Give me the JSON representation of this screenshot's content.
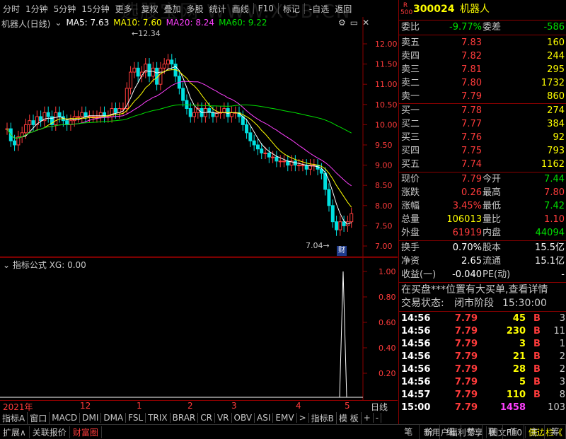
{
  "toolbar": {
    "watermark": "选股宝网 WWW.XGB.CN",
    "items": [
      "分时",
      "1分钟",
      "5分钟",
      "15分钟",
      "更多",
      "复权",
      "叠加",
      "多股",
      "统计",
      "画线",
      "F10",
      "标记",
      "-自选",
      "返回"
    ]
  },
  "stock": {
    "code": "300024",
    "name": "机器人",
    "badge_top": "R",
    "badge_bottom": "500"
  },
  "main_chart": {
    "title": "机器人(日线)",
    "ma": [
      {
        "label": "MA5: 7.63",
        "color": "#ffffff"
      },
      {
        "label": "MA10: 7.60",
        "color": "#ffff00"
      },
      {
        "label": "MA20: 8.24",
        "color": "#ff40ff"
      },
      {
        "label": "MA60: 9.22",
        "color": "#00e000"
      }
    ],
    "high_label": "12.34",
    "low_label": "7.04",
    "fin_badge": "财",
    "y_ticks": [
      "12.00",
      "11.50",
      "11.00",
      "10.50",
      "10.00",
      "9.50",
      "9.00",
      "8.50",
      "8.00",
      "7.50",
      "7.00"
    ]
  },
  "ind_chart": {
    "title": "指标公式 XG: 0.00",
    "y_ticks": [
      "1.00",
      "0.80",
      "0.60",
      "0.40",
      "0.20"
    ]
  },
  "x_axis": {
    "labels": [
      "2021年",
      "12",
      "1",
      "2",
      "3",
      "4",
      "5"
    ],
    "period": "日线"
  },
  "order_book": {
    "weibi_label": "委比",
    "weibi_value": "-9.77%",
    "weicha_label": "委差",
    "weicha_value": "-586",
    "sells": [
      {
        "label": "卖五",
        "price": "7.83",
        "vol": "160"
      },
      {
        "label": "卖四",
        "price": "7.82",
        "vol": "244"
      },
      {
        "label": "卖三",
        "price": "7.81",
        "vol": "295"
      },
      {
        "label": "卖二",
        "price": "7.80",
        "vol": "1732"
      },
      {
        "label": "卖一",
        "price": "7.79",
        "vol": "860"
      }
    ],
    "buys": [
      {
        "label": "买一",
        "price": "7.78",
        "vol": "274"
      },
      {
        "label": "买二",
        "price": "7.77",
        "vol": "384"
      },
      {
        "label": "买三",
        "price": "7.76",
        "vol": "92"
      },
      {
        "label": "买四",
        "price": "7.75",
        "vol": "793"
      },
      {
        "label": "买五",
        "price": "7.74",
        "vol": "1162"
      }
    ]
  },
  "quote": [
    {
      "l1": "现价",
      "v1": "7.79",
      "c1": "#ff3b3b",
      "l2": "今开",
      "v2": "7.44",
      "c2": "#00e000"
    },
    {
      "l1": "涨跌",
      "v1": "0.26",
      "c1": "#ff3b3b",
      "l2": "最高",
      "v2": "7.80",
      "c2": "#ff3b3b"
    },
    {
      "l1": "涨幅",
      "v1": "3.45%",
      "c1": "#ff3b3b",
      "l2": "最低",
      "v2": "7.42",
      "c2": "#00e000"
    },
    {
      "l1": "总量",
      "v1": "106013",
      "c1": "#ffff00",
      "l2": "量比",
      "v2": "1.10",
      "c2": "#ff3b3b"
    },
    {
      "l1": "外盘",
      "v1": "61919",
      "c1": "#ff3b3b",
      "l2": "内盘",
      "v2": "44094",
      "c2": "#00e000"
    }
  ],
  "fund": [
    {
      "l1": "换手",
      "v1": "0.70%",
      "l2": "股本",
      "v2": "15.5亿"
    },
    {
      "l1": "净资",
      "v1": "2.65",
      "l2": "流通",
      "v2": "15.1亿"
    },
    {
      "l1": "收益(一)",
      "v1": "-0.040",
      "l2": "PE(动)",
      "v2": "-"
    }
  ],
  "news": "在买盘***位置有大买单,查看详情",
  "trade_status": {
    "label": "交易状态:",
    "state": "闭市阶段",
    "time": "15:30:00"
  },
  "ticks": [
    {
      "time": "14:56",
      "price": "7.79",
      "vol": "45",
      "side": "B",
      "n": "3",
      "vcolor": "#ffff00"
    },
    {
      "time": "14:56",
      "price": "7.79",
      "vol": "230",
      "side": "B",
      "n": "11",
      "vcolor": "#ffff00"
    },
    {
      "time": "14:56",
      "price": "7.79",
      "vol": "3",
      "side": "B",
      "n": "1",
      "vcolor": "#ffff00"
    },
    {
      "time": "14:56",
      "price": "7.79",
      "vol": "21",
      "side": "B",
      "n": "2",
      "vcolor": "#ffff00"
    },
    {
      "time": "14:56",
      "price": "7.79",
      "vol": "28",
      "side": "B",
      "n": "2",
      "vcolor": "#ffff00"
    },
    {
      "time": "14:56",
      "price": "7.79",
      "vol": "5",
      "side": "B",
      "n": "3",
      "vcolor": "#ffff00"
    },
    {
      "time": "14:57",
      "price": "7.79",
      "vol": "110",
      "side": "B",
      "n": "8",
      "vcolor": "#ffff00"
    },
    {
      "time": "15:00",
      "price": "7.79",
      "vol": "1458",
      "side": "",
      "n": "103",
      "vcolor": "#ff40ff"
    }
  ],
  "tabs_indicator": [
    "指标A",
    "窗口",
    "MACD",
    "DMI",
    "DMA",
    "FSL",
    "TRIX",
    "BRAR",
    "CR",
    "VR",
    "OBV",
    "ASI",
    "EMV",
    ">",
    "指标B",
    "模 板",
    "+",
    "-"
  ],
  "tabs_bottom": [
    "扩展∧",
    "关联报价",
    "财富圈"
  ],
  "tabs_bottom_right": [
    "新用户福利专享",
    "图文F10",
    "侧边栏《"
  ],
  "tabs_right": [
    "笔",
    "价",
    "细",
    "势",
    "联",
    "值",
    "主",
    "筹"
  ]
}
